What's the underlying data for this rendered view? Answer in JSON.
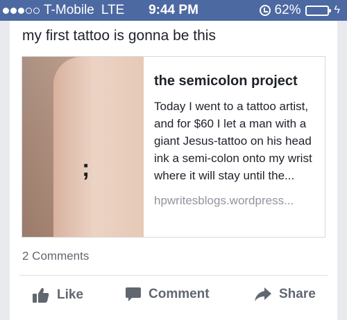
{
  "status_bar": {
    "carrier": "T-Mobile",
    "network": "LTE",
    "time": "9:44 PM",
    "battery_percent": "62%",
    "battery_level": 0.62,
    "signal_bars": 3
  },
  "post": {
    "text": "my first tattoo is gonna be this",
    "link": {
      "title": "the semicolon project",
      "description": "Today I went to a tattoo artist, and for $60 I let a man with a giant Jesus-tattoo on his head ink a semi-colon onto my wrist where it will stay until the...",
      "domain": "hpwritesblogs.wordpress...",
      "thumbnail_mark": ";"
    },
    "comments_count": "2 Comments"
  },
  "actions": {
    "like": "Like",
    "comment": "Comment",
    "share": "Share"
  },
  "colors": {
    "status_bar": "#4d69a2",
    "action_text": "#606770"
  }
}
